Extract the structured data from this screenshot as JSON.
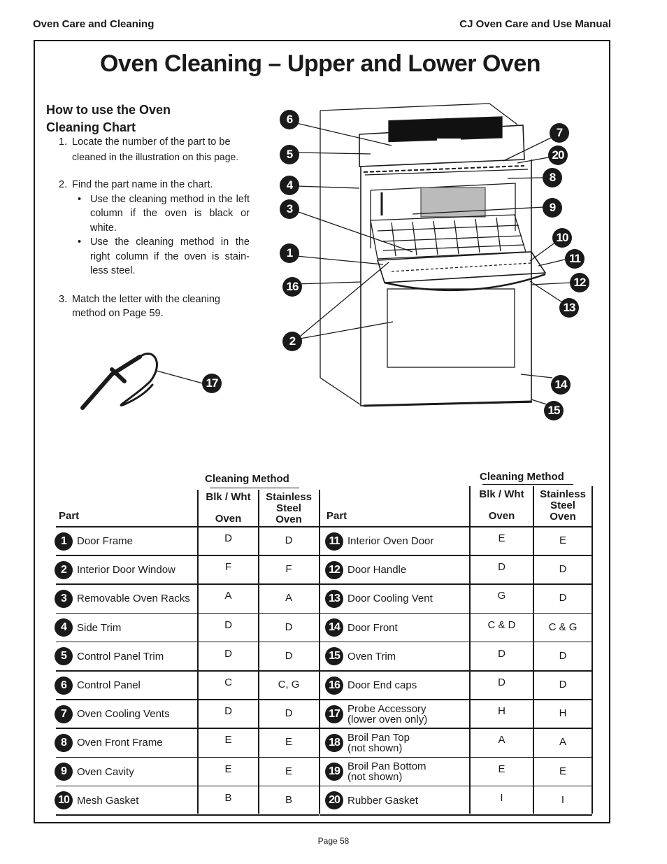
{
  "header": {
    "section": "Oven Care and Cleaning",
    "manual": "CJ Oven Care and Use Manual"
  },
  "title": "Oven Cleaning – Upper and Lower Oven",
  "instructions": {
    "heading_line1": "How to use the Oven",
    "heading_line2": "Cleaning Chart",
    "step1_num": "1.",
    "step1_line1": "Locate the number of the part to be",
    "step1_line2": "cleaned in the illustration on this page.",
    "step2_num": "2.",
    "step2_text": "Find the part name in the chart.",
    "bullet1_line1": "Use the cleaning method in the",
    "bullet1_rest": "left column if the oven is black or white.",
    "bullet2_line1": "Use the cleaning method in the",
    "bullet2_rest": "right column if the oven is stain-less steel.",
    "bullet_char": "•",
    "step3_num": "3.",
    "step3_line1": "Match the letter with the cleaning",
    "step3_line2": "method on Page 59."
  },
  "illustration": {
    "callouts": [
      "1",
      "2",
      "3",
      "4",
      "5",
      "6",
      "7",
      "8",
      "9",
      "10",
      "11",
      "12",
      "13",
      "14",
      "15",
      "16",
      "17",
      "20"
    ]
  },
  "table": {
    "cleaning_method_label": "Cleaning Method",
    "part_label": "Part",
    "col_blk_line1": "Blk / Wht",
    "col_blk_line2": "Oven",
    "col_ss_line1": "Stainless",
    "col_ss_line2": "Steel",
    "col_ss_line3": "Oven",
    "left_rows": [
      {
        "num": "1",
        "part": "Door Frame",
        "blk": "D",
        "ss": "D"
      },
      {
        "num": "2",
        "part": "Interior Door Window",
        "blk": "F",
        "ss": "F"
      },
      {
        "num": "3",
        "part": "Removable Oven Racks",
        "blk": "A",
        "ss": "A"
      },
      {
        "num": "4",
        "part": "Side Trim",
        "blk": "D",
        "ss": "D"
      },
      {
        "num": "5",
        "part": "Control Panel Trim",
        "blk": "D",
        "ss": "D"
      },
      {
        "num": "6",
        "part": "Control Panel",
        "blk": "C",
        "ss": "C, G"
      },
      {
        "num": "7",
        "part": "Oven Cooling Vents",
        "blk": "D",
        "ss": "D"
      },
      {
        "num": "8",
        "part": "Oven Front Frame",
        "blk": "E",
        "ss": "E"
      },
      {
        "num": "9",
        "part": "Oven Cavity",
        "blk": "E",
        "ss": "E"
      },
      {
        "num": "10",
        "part": "Mesh Gasket",
        "blk": "B",
        "ss": "B"
      }
    ],
    "right_rows": [
      {
        "num": "11",
        "part": "Interior Oven Door",
        "part2": "",
        "blk": "E",
        "ss": "E"
      },
      {
        "num": "12",
        "part": "Door Handle",
        "part2": "",
        "blk": "D",
        "ss": "D"
      },
      {
        "num": "13",
        "part": "Door Cooling Vent",
        "part2": "",
        "blk": "G",
        "ss": "D"
      },
      {
        "num": "14",
        "part": "Door Front",
        "part2": "",
        "blk": "C & D",
        "ss": "C & G"
      },
      {
        "num": "15",
        "part": "Oven Trim",
        "part2": "",
        "blk": "D",
        "ss": "D"
      },
      {
        "num": "16",
        "part": "Door End caps",
        "part2": "",
        "blk": "D",
        "ss": "D"
      },
      {
        "num": "17",
        "part": "Probe Accessory",
        "part2": "(lower oven only)",
        "blk": "H",
        "ss": "H"
      },
      {
        "num": "18",
        "part": "Broil Pan Top",
        "part2": "(not shown)",
        "blk": "A",
        "ss": "A"
      },
      {
        "num": "19",
        "part": "Broil Pan Bottom",
        "part2": "(not shown)",
        "blk": "E",
        "ss": "E"
      },
      {
        "num": "20",
        "part": "Rubber Gasket",
        "part2": "",
        "blk": "I",
        "ss": "I"
      }
    ]
  },
  "footer": {
    "page": "Page 58"
  }
}
